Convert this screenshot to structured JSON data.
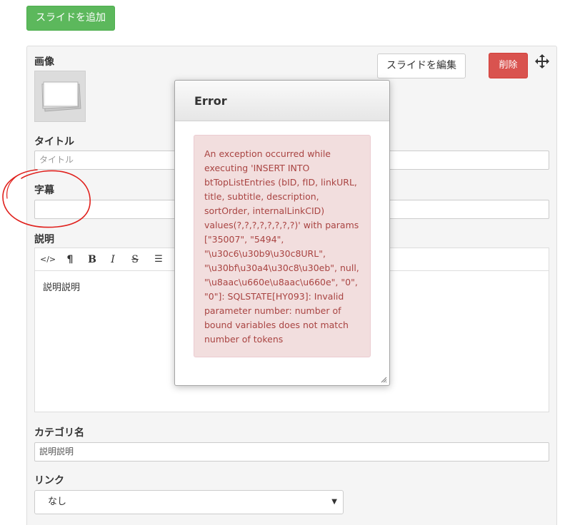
{
  "toolbar": {
    "add_slide_label": "スライドを追加"
  },
  "slide": {
    "image_label": "画像",
    "edit_label": "スライドを編集",
    "delete_label": "削除",
    "title_label": "タイトル",
    "title_placeholder": "タイトル",
    "subtitle_label": "字幕",
    "subtitle_value": "",
    "description_label": "説明",
    "description_text": "説明説明",
    "category_label": "カテゴリ名",
    "category_value": "説明説明",
    "link_label": "リンク",
    "link_selected": "なし"
  },
  "editor_toolbar": {
    "code": "</>",
    "paragraph": "¶",
    "bold": "B",
    "italic": "I",
    "strike": "S",
    "list": "☰"
  },
  "modal": {
    "title": "Error",
    "message": "An exception occurred while executing 'INSERT INTO btTopListEntries (bID, fID, linkURL, title, subtitle, description, sortOrder, internalLinkCID) values(?,?,?,?,?,?,?,?)' with params [\"35007\", \"5494\", \"\\u30c6\\u30b9\\u30c8URL\", \"\\u30bf\\u30a4\\u30c8\\u30eb\", null, \"\\u8aac\\u660e\\u8aac\\u660e\", \"0\", \"0\"]: SQLSTATE[HY093]: Invalid parameter number: number of bound variables does not match number of tokens"
  },
  "colors": {
    "success": "#5cb85c",
    "danger": "#d9534f",
    "alert_bg": "#f2dede",
    "alert_text": "#a94442",
    "annotation": "#e0201c"
  }
}
